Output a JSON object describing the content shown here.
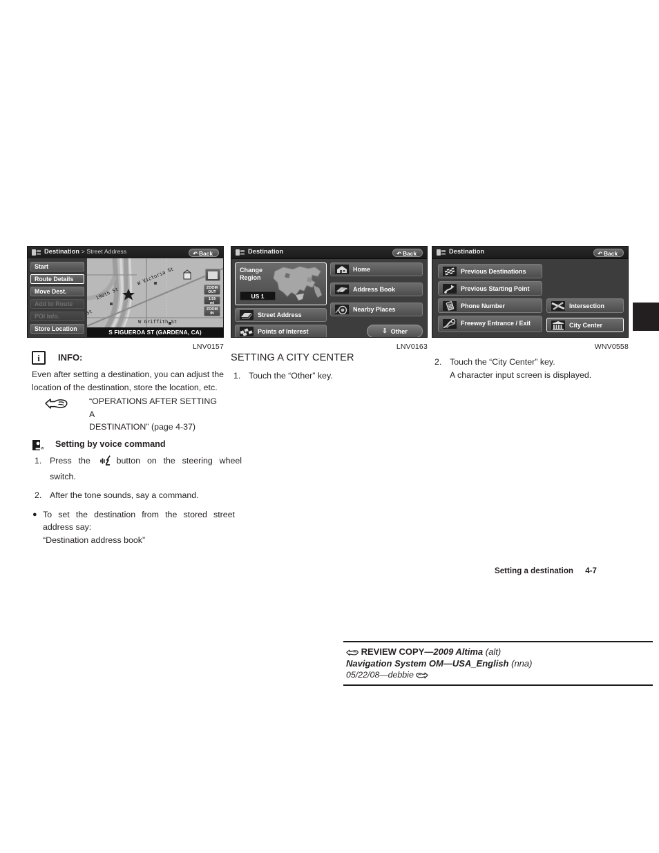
{
  "page": {
    "running_footer": "Setting a destination",
    "page_number": "4-7"
  },
  "screens": [
    {
      "caption": "LNV0157",
      "titlebar": {
        "icon": "destination-icon",
        "title": "Destination",
        "breadcrumb": "> Street Address",
        "back_label": "Back"
      },
      "menu_keys": [
        {
          "label": "Start",
          "state": "normal"
        },
        {
          "label": "Route Details",
          "state": "selected"
        },
        {
          "label": "Move Dest.",
          "state": "normal"
        },
        {
          "label": "Add to Route",
          "state": "disabled"
        },
        {
          "label": "POI Info.",
          "state": "disabled"
        },
        {
          "label": "Store Location",
          "state": "normal"
        }
      ],
      "map": {
        "status_bar": "S FIGUEROA ST (GARDENA, CA)",
        "street_labels": [
          "W Victoria St",
          "190th St",
          "W Griffith St",
          "St"
        ],
        "zoom_out_label": "ZOOM OUT",
        "zoom_in_label": "ZOOM IN",
        "scale_value": "1/16",
        "scale_unit": "mi"
      }
    },
    {
      "caption": "LNV0163",
      "titlebar": {
        "icon": "destination-icon",
        "title": "Destination",
        "breadcrumb": "",
        "back_label": "Back"
      },
      "region": {
        "label_line1": "Change",
        "label_line2": "Region",
        "tag": "US 1"
      },
      "keys": [
        {
          "label": "Street Address",
          "icon": "street-address-icon"
        },
        {
          "label": "Points of Interest",
          "icon": "poi-icon"
        },
        {
          "label": "Home",
          "icon": "home-icon"
        },
        {
          "label": "Address Book",
          "icon": "address-book-icon"
        },
        {
          "label": "Nearby Places",
          "icon": "nearby-places-icon"
        }
      ],
      "other_button": "Other"
    },
    {
      "caption": "WNV0558",
      "titlebar": {
        "icon": "destination-icon",
        "title": "Destination",
        "breadcrumb": "",
        "back_label": "Back"
      },
      "keys": [
        {
          "label": "Previous Destinations",
          "icon": "checkered-flag-icon",
          "state": "normal"
        },
        {
          "label": "Previous Starting Point",
          "icon": "starting-point-icon",
          "state": "normal"
        },
        {
          "label": "Phone Number",
          "icon": "phone-icon",
          "state": "normal"
        },
        {
          "label": "Freeway Entrance / Exit",
          "icon": "freeway-icon",
          "state": "normal"
        },
        {
          "label": "Intersection",
          "icon": "intersection-icon",
          "state": "normal"
        },
        {
          "label": "City Center",
          "icon": "city-center-icon",
          "state": "selected"
        }
      ]
    }
  ],
  "left_column": {
    "info_label": "INFO:",
    "info_body": "Even after setting a destination, you can adjust the location of the destination, store the location, etc.",
    "reference_line1": "“OPERATIONS AFTER SETTING A",
    "reference_line2": "DESTINATION” (page 4-37)",
    "voice_heading": "Setting by voice command",
    "step1_num": "1.",
    "step1_pre": "Press the",
    "step1_post": "button on the steering wheel switch.",
    "step2_num": "2.",
    "step2_text": "After the tone sounds, say a command.",
    "bullet_line1": "To set the destination from the stored street address say:",
    "bullet_line2": "“Destination address book”"
  },
  "middle_column": {
    "section_title": "SETTING A CITY CENTER",
    "step1_num": "1.",
    "step1_text": "Touch the “Other” key."
  },
  "right_column": {
    "step2_num": "2.",
    "step2_line1": "Touch the “City Center” key.",
    "step2_line2": "A character input screen is displayed."
  },
  "review_stamp": {
    "line1_pre": "REVIEW COPY—",
    "line1_title": "2009 Altima",
    "line1_paren": "(alt)",
    "line2_title": "Navigation System OM—USA_English",
    "line2_paren": "(nna)",
    "line3": "05/22/08—debbie"
  }
}
